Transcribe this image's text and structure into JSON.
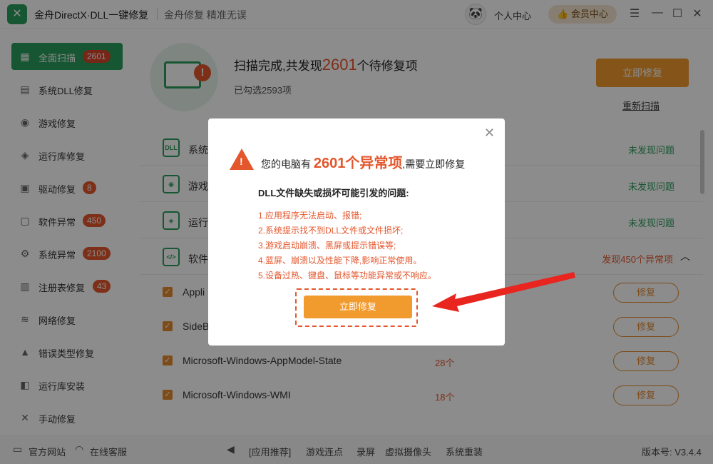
{
  "app": {
    "logo_icon": "wrench-screwdriver-icon",
    "title": "金舟DirectX·DLL一键修复",
    "slogan": "金舟修复 精准无误",
    "user_center": "个人中心",
    "vip": "会员中心"
  },
  "sidebar": {
    "items": [
      {
        "label": "全面扫描",
        "badge": "2601",
        "icon": "▦"
      },
      {
        "label": "系统DLL修复",
        "badge": "",
        "icon": "▤"
      },
      {
        "label": "游戏修复",
        "badge": "",
        "icon": "◉"
      },
      {
        "label": "运行库修复",
        "badge": "",
        "icon": "◈"
      },
      {
        "label": "驱动修复",
        "badge": "8",
        "icon": "▣"
      },
      {
        "label": "软件异常",
        "badge": "450",
        "icon": "▢"
      },
      {
        "label": "系统异常",
        "badge": "2100",
        "icon": "⚙"
      },
      {
        "label": "注册表修复",
        "badge": "43",
        "icon": "▥"
      },
      {
        "label": "网络修复",
        "badge": "",
        "icon": "≋"
      },
      {
        "label": "错误类型修复",
        "badge": "",
        "icon": "▲"
      },
      {
        "label": "运行库安装",
        "badge": "",
        "icon": "◧"
      },
      {
        "label": "手动修复",
        "badge": "",
        "icon": "✕"
      }
    ]
  },
  "summary": {
    "text_prefix": "扫描完成,共发现",
    "count": "2601",
    "text_suffix": "个待修复项",
    "selected": "已勾选2593项",
    "fix_now": "立即修复",
    "rescan": "重新扫描"
  },
  "categories": [
    {
      "label": "系统",
      "icon": "DLL",
      "status": "未发现问题"
    },
    {
      "label": "游戏",
      "icon": "◉",
      "status": "未发现问题"
    },
    {
      "label": "运行",
      "icon": "◈",
      "status": "未发现问题"
    },
    {
      "label": "软件",
      "icon": "</>",
      "status": "发现450个异常项"
    }
  ],
  "items": [
    {
      "name": "Appli",
      "count": "",
      "fix": "修复"
    },
    {
      "name": "SideB",
      "count": "",
      "fix": "修复"
    },
    {
      "name": "Microsoft-Windows-AppModel-State",
      "count": "28个",
      "fix": "修复"
    },
    {
      "name": "Microsoft-Windows-WMI",
      "count": "18个",
      "fix": "修复"
    }
  ],
  "modal": {
    "head_prefix": "您的电脑有",
    "head_count": "2601个异常项",
    "head_suffix": ",需要立即修复",
    "sub": "DLL文件缺失或损坏可能引发的问题:",
    "issues": [
      "1.应用程序无法启动、报错;",
      "2.系统提示找不到DLL文件或文件损坏;",
      "3.游戏启动崩溃、黑屏或提示错误等;",
      "4.蓝屏、崩溃以及性能下降,影响正常使用。",
      "5.设备过热、键盘、鼠标等功能异常或不响应。"
    ],
    "button": "立即修复"
  },
  "footer": {
    "official_site": "官方网站",
    "online_service": "在线客服",
    "recommend": "[应用推荐]",
    "links": [
      "游戏连点",
      "录屏",
      "虚拟摄像头",
      "系统重装"
    ],
    "version": "版本号: V3.4.4"
  }
}
